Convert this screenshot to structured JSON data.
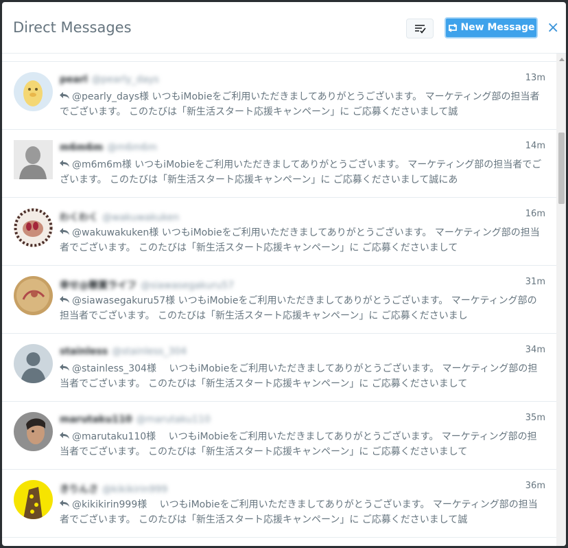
{
  "header": {
    "title": "Direct Messages",
    "new_message_label": "New Message",
    "close_glyph": "×"
  },
  "colors": {
    "accent": "#3ea2eb",
    "text_muted": "#66757f",
    "handle": "#8899a6"
  },
  "conversations": [
    {
      "name": "pearl",
      "handle": "@pearly_days",
      "time": "13m",
      "preview": "@pearly_days様 いつもiMobieをご利用いただきましてありがとうございます。 マーケティング部の担当者でございます。 このたびは「新生活スタート応援キャンペーン」に ご応募くださいまして誠",
      "avatar_icon": "cartoon-avatar"
    },
    {
      "name": "m6m6m",
      "handle": "@m6m6m",
      "time": "14m",
      "preview": "@m6m6m様 いつもiMobieをご利用いただきましてありがとうございます。 マーケティング部の担当者でございます。 このたびは「新生活スタート応援キャンペーン」に ご応募くださいまして誠にあ",
      "avatar_icon": "statue-avatar"
    },
    {
      "name": "わくわく",
      "handle": "@wakuwakuken",
      "time": "16m",
      "preview": "@wakuwakuken様 いつもiMobieをご利用いただきましてありがとうございます。 マーケティング部の担当者でございます。 このたびは「新生活スタート応援キャンペーン」に ご応募くださいまして",
      "avatar_icon": "nails-avatar"
    },
    {
      "name": "幸せ@懸賞ライフ",
      "handle": "@siawasegakuru57",
      "time": "31m",
      "preview": "@siawasegakuru57様 いつもiMobieをご利用いただきましてありがとうございます。 マーケティング部の担当者でございます。 このたびは「新生活スタート応援キャンペーン」に ご応募くださいまし",
      "avatar_icon": "painting-avatar"
    },
    {
      "name": "stainless",
      "handle": "@stainless_304",
      "time": "34m",
      "preview": "@stainless_304様　 いつもiMobieをご利用いただきましてありがとうございます。 マーケティング部の担当者でございます。 このたびは「新生活スタート応援キャンペーン」に ご応募くださいまして",
      "avatar_icon": "default-avatar"
    },
    {
      "name": "marutaku110",
      "handle": "@marutaku110",
      "time": "35m",
      "preview": "@marutaku110様　 いつもiMobieをご利用いただきましてありがとうございます。 マーケティング部の担当者でございます。 このたびは「新生活スタート応援キャンペーン」に ご応募くださいまして",
      "avatar_icon": "photo-avatar"
    },
    {
      "name": "きりんさ",
      "handle": "@kikikirin999",
      "time": "36m",
      "preview": "@kikikirin999様　 いつもiMobieをご利用いただきましてありがとうございます。 マーケティング部の担当者でございます。 このたびは「新生活スタート応援キャンペーン」に ご応募くださいまして誠",
      "avatar_icon": "giraffe-avatar"
    }
  ]
}
